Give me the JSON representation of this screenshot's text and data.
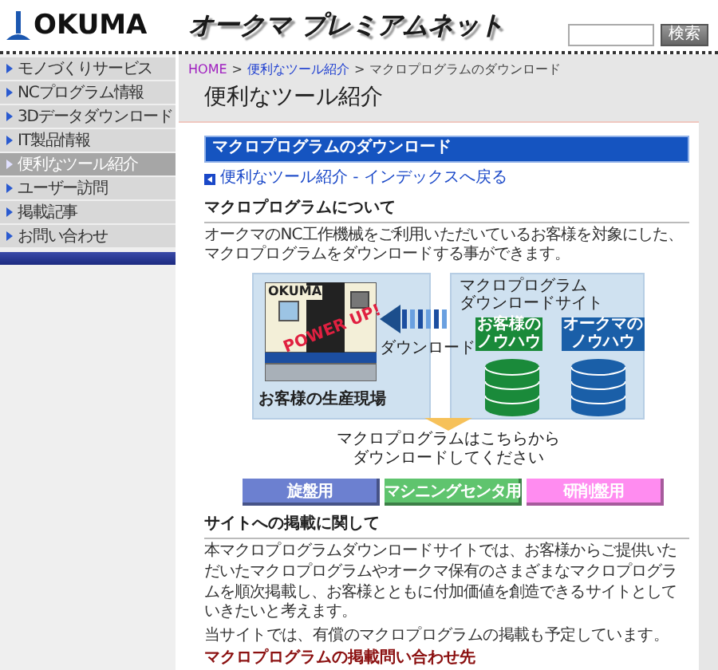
{
  "header": {
    "logo_text": "OKUMA",
    "site_title": "オークマ プレミアムネット",
    "search_button": "検索"
  },
  "sidebar": {
    "items": [
      {
        "label": "モノづくりサービス",
        "selected": false
      },
      {
        "label": "NCプログラム情報",
        "selected": false
      },
      {
        "label": "3Dデータダウンロード",
        "selected": false
      },
      {
        "label": "IT製品情報",
        "selected": false
      },
      {
        "label": "便利なツール紹介",
        "selected": true
      },
      {
        "label": "ユーザー訪問",
        "selected": false
      },
      {
        "label": "掲載記事",
        "selected": false
      },
      {
        "label": "お問い合わせ",
        "selected": false
      }
    ]
  },
  "breadcrumb": {
    "separator": ">",
    "items": [
      {
        "label": "HOME",
        "kind": "visited"
      },
      {
        "label": "便利なツール紹介",
        "kind": "link"
      },
      {
        "label": "マクロプログラムのダウンロード",
        "kind": "current"
      }
    ]
  },
  "page_title": "便利なツール紹介",
  "section_bar": "マクロプログラムのダウンロード",
  "back_link": "便利なツール紹介 - インデックスへ戻る",
  "about": {
    "heading": "マクロプログラムについて",
    "text": "オークマのNC工作機械をご利用いただいているお客様を対象にした、マクロプログラムをダウンロードする事ができます。"
  },
  "diagram": {
    "machine_logo": "OKUMA",
    "stamp": "POWER UP!",
    "arrow_label": "ダウンロード",
    "factory_label": "お客様の生産現場",
    "site_label": [
      "マクロプログラム",
      "ダウンロードサイト"
    ],
    "databases": [
      {
        "label": [
          "お客様の",
          "ノウハウ"
        ],
        "color": "#1a8a3a"
      },
      {
        "label": [
          "オークマの",
          "ノウハウ"
        ],
        "color": "#1a5fa8"
      }
    ],
    "caption": [
      "マクロプログラムはこちらから",
      "ダウンロードしてください"
    ]
  },
  "download_buttons": [
    {
      "label": "旋盤用",
      "color": "#6c80d0"
    },
    {
      "label": "マシニングセンタ用",
      "color": "#5fc46e"
    },
    {
      "label": "研削盤用",
      "color": "#ff8cf0"
    }
  ],
  "posting": {
    "heading": "サイトへの掲載に関して",
    "text": "本マクロプログラムダウンロードサイトでは、お客様からご提供いただいたマクロプログラムやオークマ保有のさまざまなマクロプログラムを順次掲載し、お客様とともに付加価値を創造できるサイトとしていきたいと考えます。",
    "note": "当サイトでは、有償のマクロプログラムの掲載も予定しています。"
  },
  "contact_heading": "マクロプログラムの掲載問い合わせ先"
}
